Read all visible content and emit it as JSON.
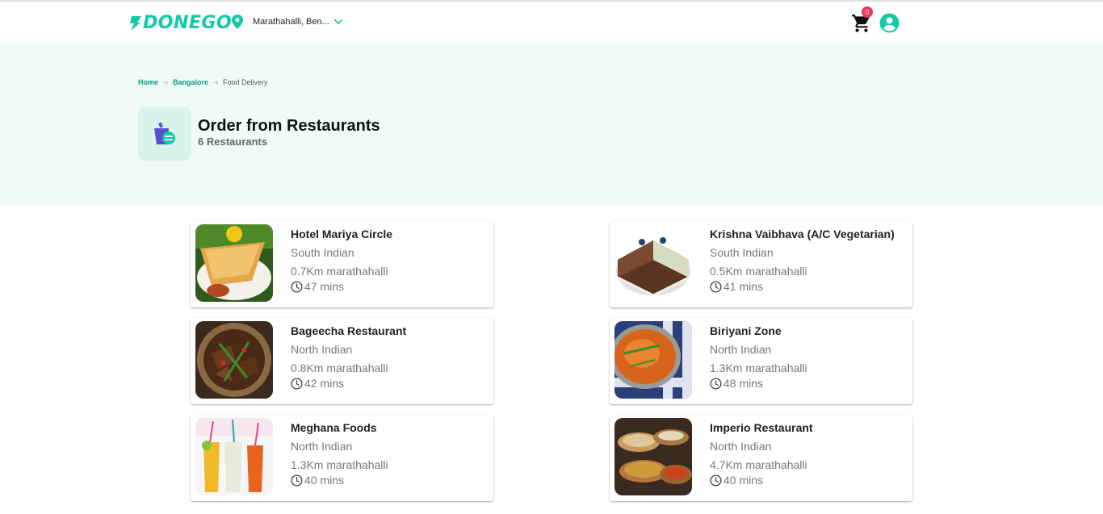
{
  "header": {
    "logo": "DONEGO",
    "location": "Marathahalli, Ben...",
    "cart_count": "0",
    "icons": {
      "location": "location-pin-icon",
      "dropdown": "chevron-down-icon",
      "cart": "cart-icon",
      "account": "account-circle-icon"
    }
  },
  "breadcrumb": [
    "Home",
    "Bangalore",
    "Food Delivery"
  ],
  "category": {
    "title": "Order from Restaurants",
    "count": "6 Restaurants",
    "icon": "food-delivery-icon"
  },
  "restaurants": [
    {
      "name": "Hotel Mariya Circle",
      "cuisine": "South Indian",
      "distance": "0.7Km marathahalli",
      "time": "47 mins"
    },
    {
      "name": "Krishna Vaibhava (A/C Vegetarian)",
      "cuisine": "South Indian",
      "distance": "0.5Km marathahalli",
      "time": "41 mins"
    },
    {
      "name": "Bageecha Restaurant",
      "cuisine": "North Indian",
      "distance": "0.8Km marathahalli",
      "time": "42 mins"
    },
    {
      "name": "Biriyani Zone",
      "cuisine": "North Indian",
      "distance": "1.3Km marathahalli",
      "time": "48 mins"
    },
    {
      "name": "Meghana Foods",
      "cuisine": "North Indian",
      "distance": "1.3Km marathahalli",
      "time": "40 mins"
    },
    {
      "name": "Imperio Restaurant",
      "cuisine": "North Indian",
      "distance": "4.7Km marathahalli",
      "time": "40 mins"
    }
  ],
  "colors": {
    "brand": "#13c9a8",
    "hero_bg": "#f0fbf7",
    "badge": "#f0375a",
    "link": "#0a9a7a"
  }
}
